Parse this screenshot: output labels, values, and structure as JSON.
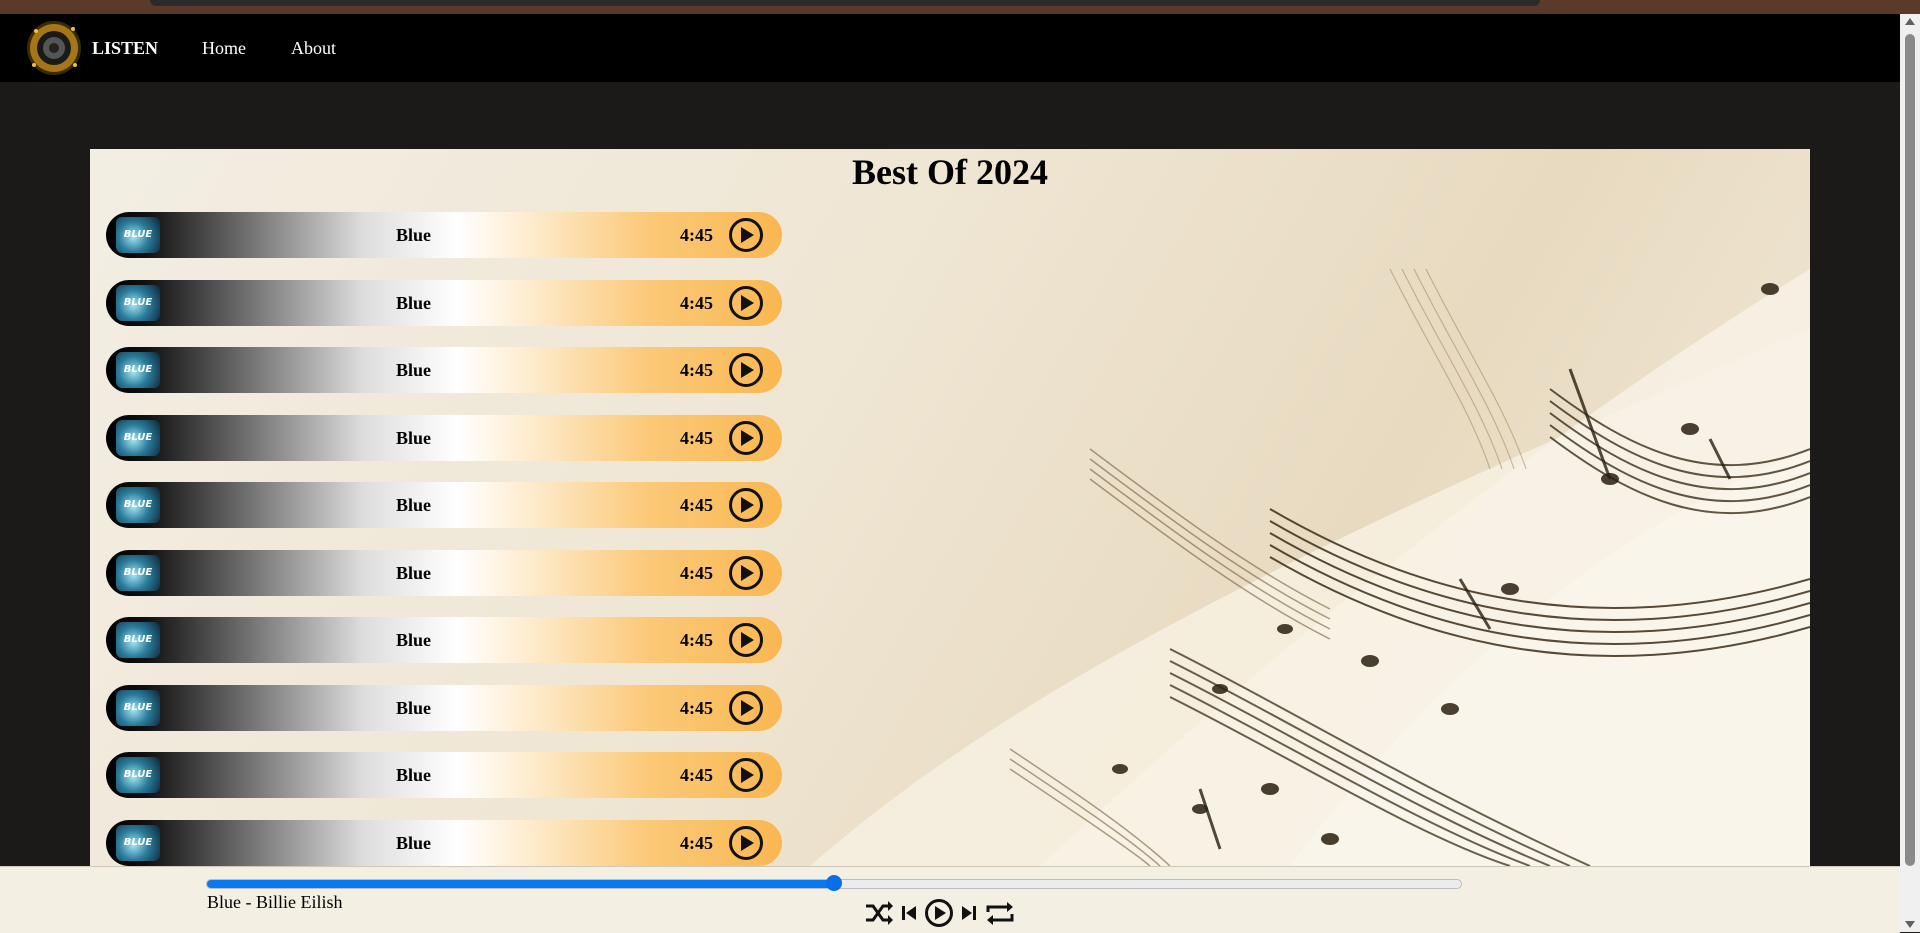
{
  "nav": {
    "brand": "LISTEN",
    "links": [
      "Home",
      "About"
    ]
  },
  "panel": {
    "title": "Best Of 2024"
  },
  "tracks": [
    {
      "title": "Blue",
      "duration": "4:45",
      "art": "BLUE"
    },
    {
      "title": "Blue",
      "duration": "4:45",
      "art": "BLUE"
    },
    {
      "title": "Blue",
      "duration": "4:45",
      "art": "BLUE"
    },
    {
      "title": "Blue",
      "duration": "4:45",
      "art": "BLUE"
    },
    {
      "title": "Blue",
      "duration": "4:45",
      "art": "BLUE"
    },
    {
      "title": "Blue",
      "duration": "4:45",
      "art": "BLUE"
    },
    {
      "title": "Blue",
      "duration": "4:45",
      "art": "BLUE"
    },
    {
      "title": "Blue",
      "duration": "4:45",
      "art": "BLUE"
    },
    {
      "title": "Blue",
      "duration": "4:45",
      "art": "BLUE"
    },
    {
      "title": "Blue",
      "duration": "4:45",
      "art": "BLUE"
    }
  ],
  "player": {
    "now_playing": "Blue - Billie Eilish",
    "progress": 0.5,
    "controls": [
      "shuffle-icon",
      "previous-icon",
      "play-icon",
      "next-icon",
      "repeat-icon"
    ],
    "accent": "#0a78f0"
  },
  "colors": {
    "track_gradient_end": "#f9b751",
    "navbar": "#000000"
  }
}
